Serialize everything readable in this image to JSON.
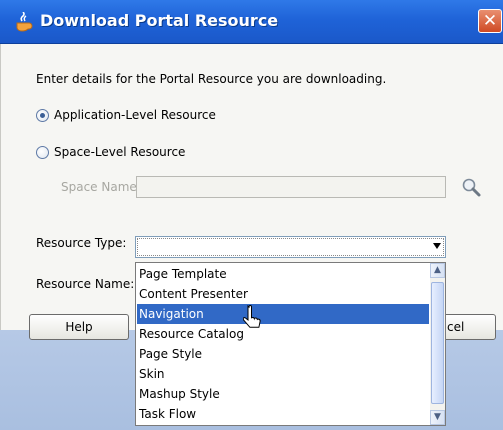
{
  "window": {
    "title": "Download Portal Resource",
    "close_glyph": "✕"
  },
  "form": {
    "intro": "Enter details for the Portal Resource you are downloading.",
    "radio_application": "Application-Level Resource",
    "radio_space": "Space-Level Resource",
    "selected_radio": "application",
    "space_name_label": "Space Name",
    "space_name_value": "",
    "resource_type_label": "Resource Type:",
    "resource_type_value": "",
    "resource_name_label": "Resource Name:"
  },
  "buttons": {
    "help": "Help",
    "cancel_visible_text": "cel"
  },
  "dropdown": {
    "items": [
      "Page Template",
      "Content Presenter",
      "Navigation",
      "Resource Catalog",
      "Page Style",
      "Skin",
      "Mashup Style",
      "Task Flow"
    ],
    "highlighted": "Navigation"
  },
  "colors": {
    "titlebar": "#1f63d8",
    "selection": "#3169c6",
    "dialog_bg": "#f6f6f3"
  },
  "icons": {
    "title": "oracle-coffee-cup-icon",
    "search": "magnifier-icon"
  }
}
